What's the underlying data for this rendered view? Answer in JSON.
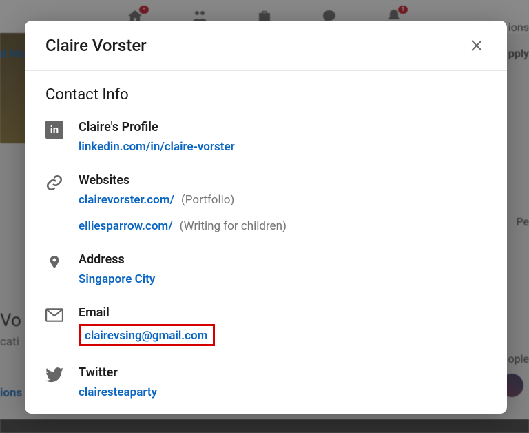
{
  "background": {
    "nav_items": [
      "home",
      "network",
      "jobs",
      "messaging",
      "notifications"
    ],
    "apply_text": "pply",
    "ions_text": "ions",
    "search_link": "d Ma",
    "pe_text": "Pe",
    "vo_text": "Vo",
    "cat_text": "cati",
    "ions2_text": "ions",
    "ople_text": "ople"
  },
  "modal": {
    "title": "Claire Vorster",
    "heading": "Contact Info",
    "profile": {
      "label": "Claire's Profile",
      "link_text": "linkedin.com/in/claire-vorster"
    },
    "websites": {
      "label": "Websites",
      "list": [
        {
          "link": "clairevorster.com/",
          "desc": "(Portfolio)"
        },
        {
          "link": "elliesparrow.com/",
          "desc": "(Writing for children)"
        }
      ]
    },
    "address": {
      "label": "Address",
      "value": "Singapore City"
    },
    "email": {
      "label": "Email",
      "value": "clairevsing@gmail.com"
    },
    "twitter": {
      "label": "Twitter",
      "value": "clairesteaparty"
    }
  }
}
